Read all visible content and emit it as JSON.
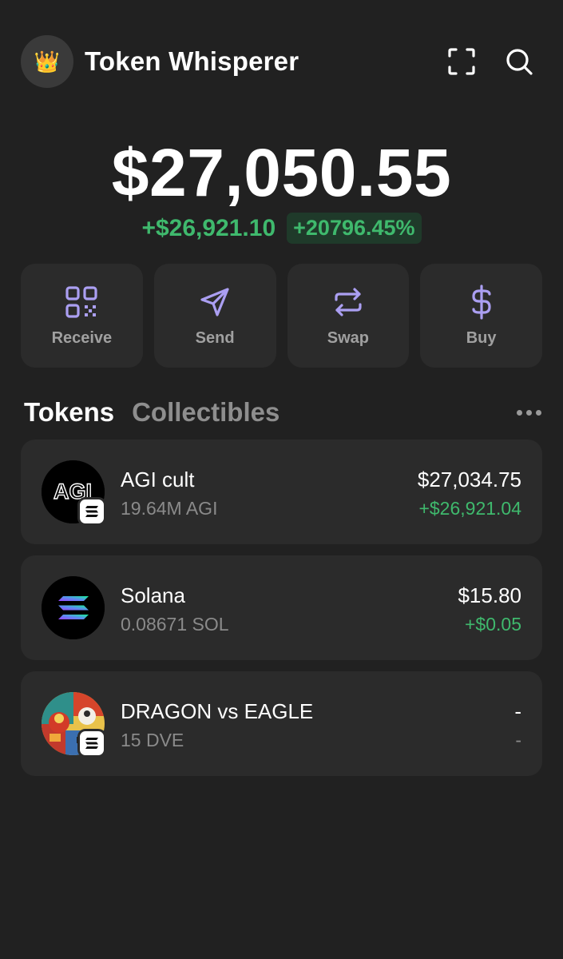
{
  "header": {
    "avatar_emoji": "👑",
    "account_name": "Token Whisperer",
    "icons": [
      "scan-icon",
      "search-icon"
    ]
  },
  "balance": {
    "total": "$27,050.55",
    "change_amount": "+$26,921.10",
    "change_percent": "+20796.45%"
  },
  "actions": [
    {
      "label": "Receive",
      "icon": "qr-code-icon"
    },
    {
      "label": "Send",
      "icon": "send-icon"
    },
    {
      "label": "Swap",
      "icon": "swap-icon"
    },
    {
      "label": "Buy",
      "icon": "dollar-icon"
    }
  ],
  "tabs": [
    {
      "label": "Tokens",
      "active": true
    },
    {
      "label": "Collectibles",
      "active": false
    }
  ],
  "tokens": [
    {
      "name": "AGI cult",
      "quantity": "19.64M AGI",
      "value": "$27,034.75",
      "change": "+$26,921.04",
      "logo_text": "AGI"
    },
    {
      "name": "Solana",
      "quantity": "0.08671 SOL",
      "value": "$15.80",
      "change": "+$0.05"
    },
    {
      "name": "DRAGON vs EAGLE",
      "quantity": "15 DVE",
      "value": "-",
      "change": "-"
    }
  ],
  "colors": {
    "background": "#212121",
    "card": "#2b2b2b",
    "accent": "#ab9ff2",
    "positive": "#3fb96d",
    "muted_text": "#8a8a8a"
  }
}
